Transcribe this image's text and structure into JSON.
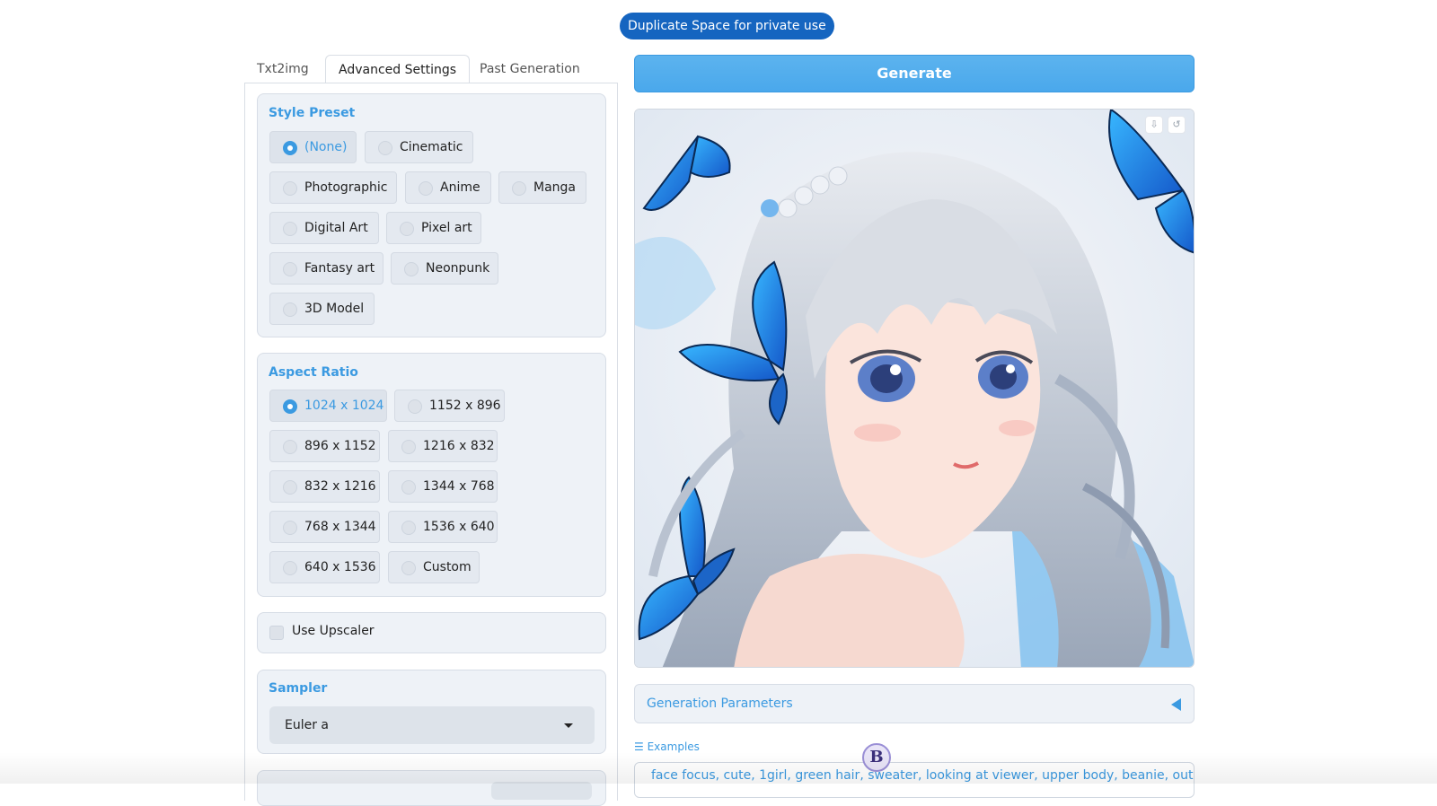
{
  "header": {
    "duplicate_label": "Duplicate Space for private use"
  },
  "tabs": [
    {
      "label": "Txt2img"
    },
    {
      "label": "Advanced Settings"
    },
    {
      "label": "Past Generation"
    }
  ],
  "style_preset": {
    "title": "Style Preset",
    "selected": "(None)",
    "options": [
      "(None)",
      "Cinematic",
      "Photographic",
      "Anime",
      "Manga",
      "Digital Art",
      "Pixel art",
      "Fantasy art",
      "Neonpunk",
      "3D Model"
    ]
  },
  "aspect_ratio": {
    "title": "Aspect Ratio",
    "selected": "1024 x 1024",
    "options": [
      "1024 x 1024",
      "1152 x 896",
      "896 x 1152",
      "1216 x 832",
      "832 x 1216",
      "1344 x 768",
      "768 x 1344",
      "1536 x 640",
      "640 x 1536",
      "Custom"
    ]
  },
  "upscaler": {
    "label": "Use Upscaler",
    "checked": false
  },
  "sampler": {
    "title": "Sampler",
    "value": "Euler a"
  },
  "generate": {
    "label": "Generate"
  },
  "output_image": {
    "icons": [
      "download-icon",
      "share-icon"
    ]
  },
  "generation_parameters": {
    "label": "Generation Parameters"
  },
  "examples": {
    "label": "Examples",
    "first": "face focus, cute, 1girl, green hair, sweater, looking at viewer, upper body, beanie, outdoors,"
  },
  "colors": {
    "accent": "#3b9ae1",
    "duplicate_button": "#1565c0",
    "panel_bg": "#eef2f7"
  }
}
